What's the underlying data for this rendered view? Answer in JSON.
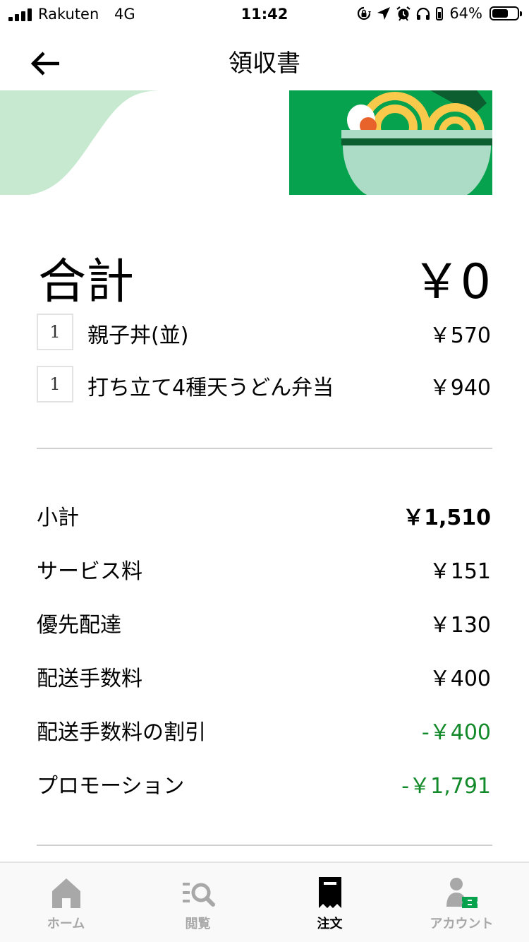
{
  "status_bar": {
    "carrier": "Rakuten",
    "network": "4G",
    "time": "11:42",
    "battery_percent": "64%",
    "battery_level": 0.64,
    "icons": [
      "signal-icon",
      "orientation-lock-icon",
      "location-icon",
      "alarm-icon",
      "headphones-icon",
      "battery-icon"
    ]
  },
  "header": {
    "title": "領収書",
    "back_icon": "back-arrow-icon"
  },
  "banner": {
    "image": "noodle-bowl-illustration",
    "colors": {
      "light_green": "#c6e9d0",
      "green": "#06a24e",
      "dark_green": "#0c5e30",
      "bowl": "#acdcc6"
    }
  },
  "total": {
    "label": "合計",
    "value": "￥0"
  },
  "items": [
    {
      "qty": "1",
      "name": "親子丼(並)",
      "price": "￥570"
    },
    {
      "qty": "1",
      "name": "打ち立て4種天うどん弁当",
      "price": "￥940"
    }
  ],
  "breakdown": [
    {
      "label": "小計",
      "value": "￥1,510",
      "style": "bold"
    },
    {
      "label": "サービス料",
      "value": "￥151",
      "style": "normal"
    },
    {
      "label": "優先配達",
      "value": "￥130",
      "style": "normal"
    },
    {
      "label": "配送手数料",
      "value": "￥400",
      "style": "normal"
    },
    {
      "label": "配送手数料の割引",
      "value": "-￥400",
      "style": "green"
    },
    {
      "label": "プロモーション",
      "value": "-￥1,791",
      "style": "green"
    }
  ],
  "tab_bar": {
    "tabs": [
      {
        "label": "ホーム",
        "icon": "home-icon",
        "active": false
      },
      {
        "label": "閲覧",
        "icon": "browse-search-icon",
        "active": false
      },
      {
        "label": "注文",
        "icon": "receipt-icon",
        "active": true
      },
      {
        "label": "アカウント",
        "icon": "account-icon",
        "active": false
      }
    ],
    "active_color": "#000000",
    "inactive_color": "#a8a8a8"
  }
}
